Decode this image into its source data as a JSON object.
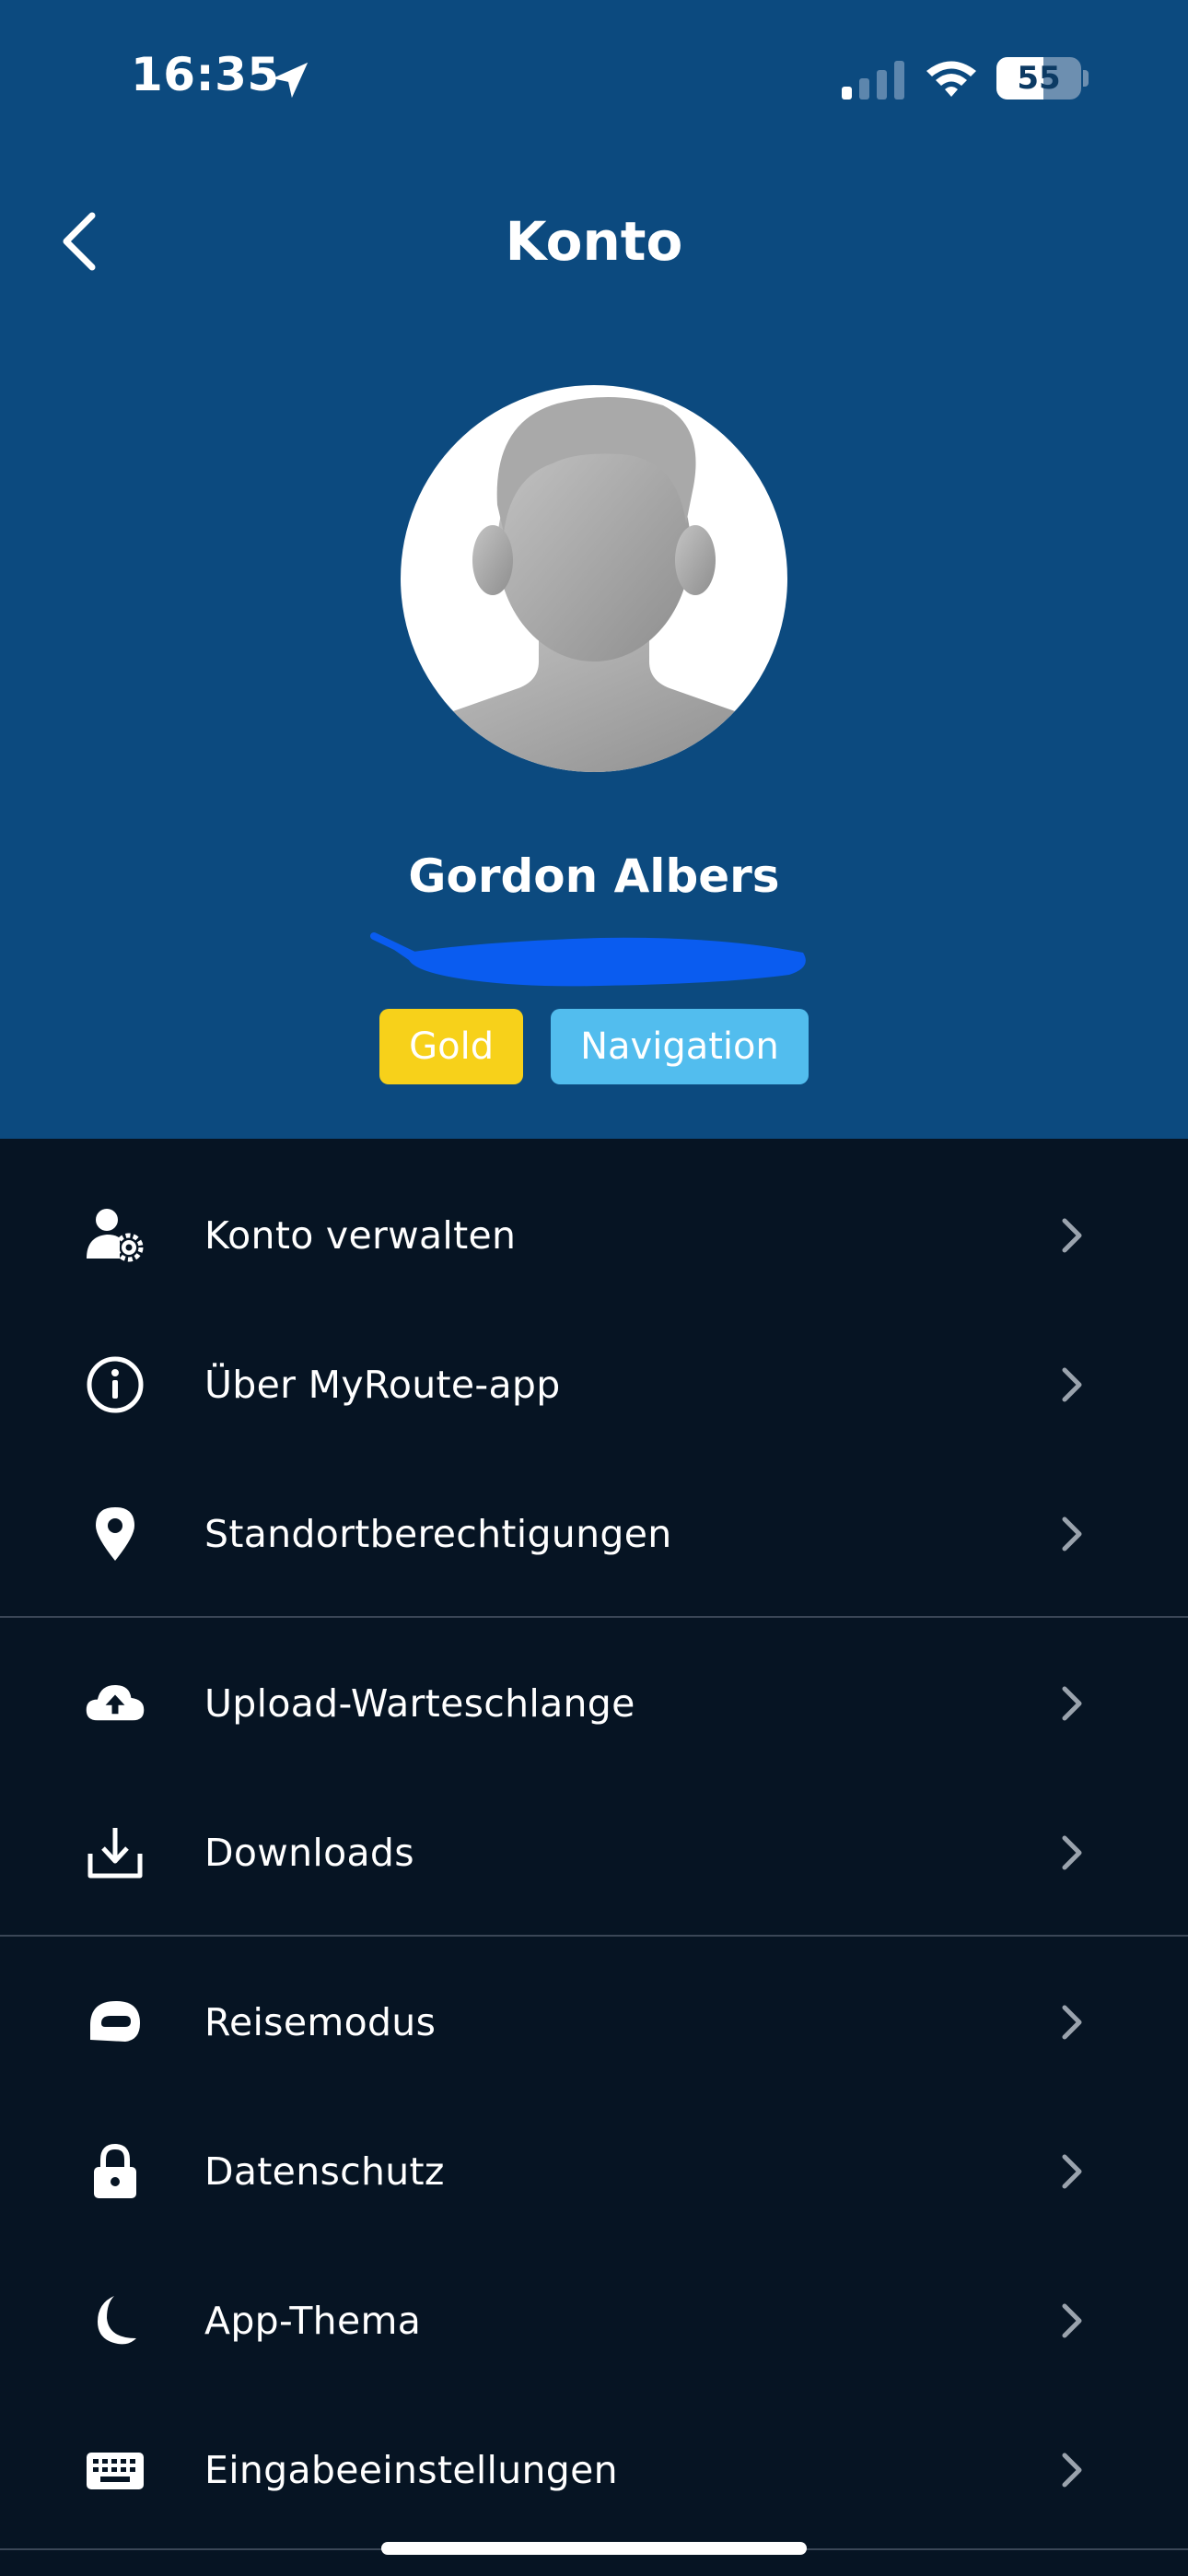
{
  "status_bar": {
    "time": "16:35",
    "battery": "55",
    "icons": [
      "location-arrow-icon",
      "cellular-signal-icon",
      "wifi-icon",
      "battery-icon"
    ]
  },
  "header": {
    "title": "Konto",
    "back_icon": "chevron-left-icon"
  },
  "profile": {
    "name": "Gordon Albers",
    "avatar_icon": "default-person-avatar",
    "badges": {
      "gold": "Gold",
      "navigation": "Navigation"
    }
  },
  "menu": {
    "items": [
      {
        "label": "Konto verwalten",
        "icon": "user-gear-icon"
      },
      {
        "label": "Über MyRoute-app",
        "icon": "info-circle-icon"
      },
      {
        "label": "Standortberechtigungen",
        "icon": "map-pin-icon"
      },
      {
        "label": "Upload-Warteschlange",
        "icon": "cloud-upload-icon"
      },
      {
        "label": "Downloads",
        "icon": "download-tray-icon"
      },
      {
        "label": "Reisemodus",
        "icon": "helmet-icon"
      },
      {
        "label": "Datenschutz",
        "icon": "lock-icon"
      },
      {
        "label": "App-Thema",
        "icon": "moon-icon"
      },
      {
        "label": "Eingabeeinstellungen",
        "icon": "keyboard-icon"
      }
    ]
  },
  "colors": {
    "header_bg": "#0c4a7f",
    "body_bg": "#061423",
    "badge_gold": "#f7d11a",
    "badge_navigation": "#52bdee",
    "redaction": "#0a5cf0"
  }
}
